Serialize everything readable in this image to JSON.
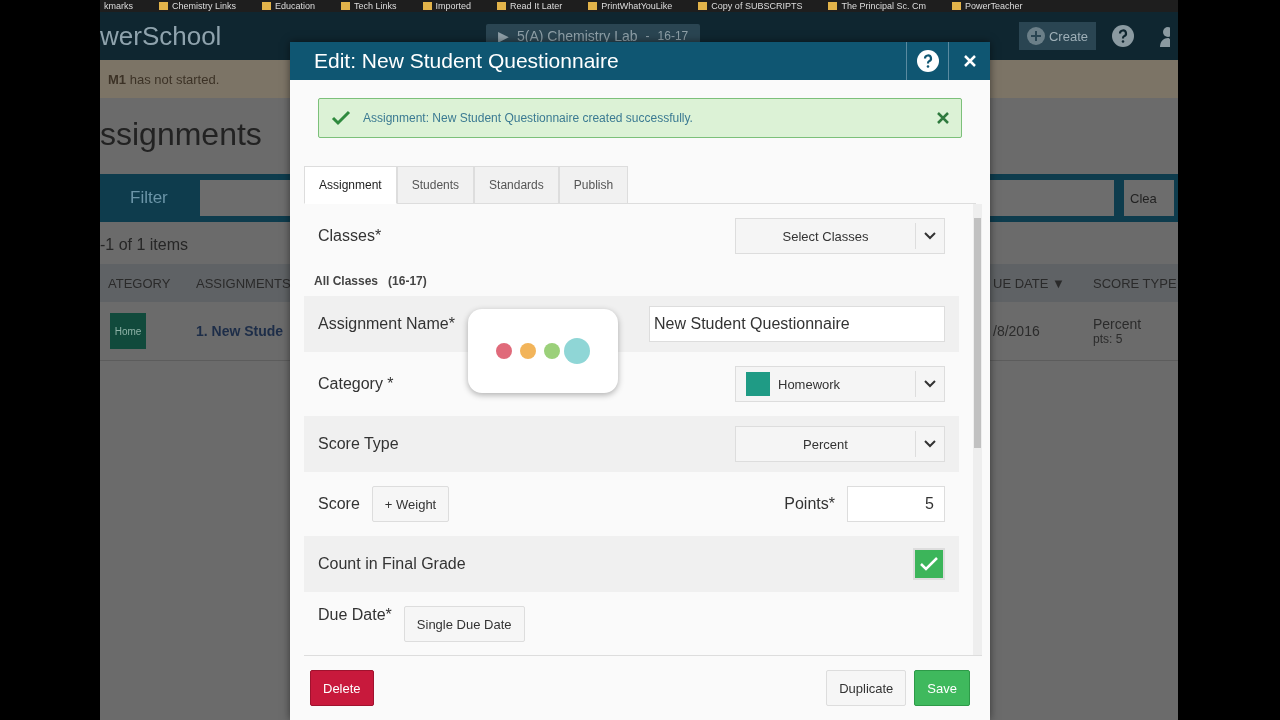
{
  "bookmarks": [
    "kmarks",
    "Chemistry Links",
    "Education",
    "Tech Links",
    "Imported",
    "Read It Later",
    "PrintWhatYouLike",
    "Copy of SUBSCRIPTS",
    "The Principal Sc. Cm",
    "PowerTeacher"
  ],
  "app_header": {
    "brand": "werSchool",
    "class_arrow": "▶",
    "class_name": "5(A) Chemistry Lab",
    "class_sep": "-",
    "class_term": "16-17",
    "create": "Create"
  },
  "notice": {
    "bold": "M1",
    "text": "has not started."
  },
  "page_title": "ssignments",
  "filter": {
    "label": "Filter",
    "clear": "Clea"
  },
  "items_count": "-1 of 1 items",
  "table": {
    "columns": [
      "ATEGORY",
      "ASSIGNMENTS",
      "UE DATE ▼",
      "SCORE TYPE"
    ],
    "rows": [
      {
        "category": "Home",
        "assignment": "1. New Stude",
        "due_date": "/8/2016",
        "score_type": "Percent",
        "points": "pts: 5"
      }
    ]
  },
  "dialog": {
    "title": "Edit: New Student Questionnaire",
    "alert": "Assignment: New Student Questionnaire created successfully.",
    "tabs": [
      {
        "label": "Assignment",
        "selected": true
      },
      {
        "label": "Students",
        "selected": false
      },
      {
        "label": "Standards",
        "selected": false
      },
      {
        "label": "Publish",
        "selected": false
      }
    ],
    "fields": [
      {
        "kind": "select",
        "label": "Classes*",
        "value": "Select Classes",
        "note": "All Classes",
        "note_term": "(16-17)"
      },
      {
        "kind": "input",
        "label": "Assignment Name*",
        "value": "New Student Questionnaire"
      },
      {
        "kind": "select",
        "label": "Category *",
        "value": "Homework",
        "color": "#1f9b85"
      },
      {
        "kind": "select",
        "label": "Score Type",
        "value": "Percent"
      },
      {
        "kind": "score",
        "label": "Score",
        "button": "+ Weight",
        "points_label": "Points*",
        "value": "5"
      },
      {
        "kind": "checkbox",
        "label": "Count in Final Grade",
        "checked": true
      },
      {
        "kind": "button",
        "label": "Due Date*",
        "button": "Single Due Date"
      }
    ],
    "footer": {
      "delete": "Delete",
      "duplicate": "Duplicate",
      "save": "Save"
    }
  }
}
